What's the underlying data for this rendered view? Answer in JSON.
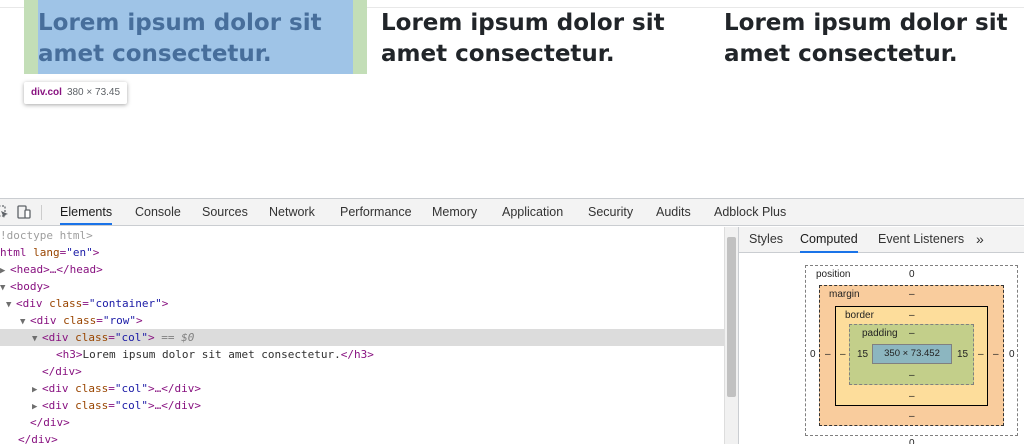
{
  "page": {
    "columns": [
      {
        "heading": "Lorem ipsum dolor sit amet consectetur."
      },
      {
        "heading": "Lorem ipsum dolor sit amet consectetur."
      },
      {
        "heading": "Lorem ipsum dolor sit amet consectetur."
      }
    ],
    "tooltip": {
      "tag": "div.col",
      "dims": "380 × 73.45"
    }
  },
  "devtools": {
    "tabs": [
      "Elements",
      "Console",
      "Sources",
      "Network",
      "Performance",
      "Memory",
      "Application",
      "Security",
      "Audits",
      "Adblock Plus"
    ],
    "active_tab": "Elements",
    "dom_lines": {
      "l0": "!doctype html>",
      "l1_tag": "html",
      "l1_attr": "lang",
      "l1_val": "\"en\"",
      "l2": "<head>…</head>",
      "l3": "<body>",
      "l4_tag": "<div",
      "l4_attr": "class",
      "l4_val": "\"container\"",
      "l5_val": "\"row\"",
      "l6_val": "\"col\"",
      "l6_suffix": "== $0",
      "l7_open": "<h3>",
      "l7_text": "Lorem ipsum dolor sit amet consectetur.",
      "l7_close": "</h3>",
      "l8": "</div>",
      "l9_val": "\"col\"",
      "l9_tail": "…</div>",
      "l10_val": "\"col\"",
      "l10_tail": "…</div>",
      "l11": "</div>",
      "l12": "</div>"
    },
    "side_tabs": [
      "Styles",
      "Computed",
      "Event Listeners",
      "»"
    ],
    "active_side_tab": "Computed",
    "box_model": {
      "position_label": "position",
      "position_top": "0",
      "position_bottom": "0",
      "position_left": "0",
      "position_right": "0",
      "margin_label": "margin",
      "margin_value": "–",
      "border_label": "border",
      "border_value": "–",
      "padding_label": "padding",
      "padding_top": "–",
      "padding_bottom": "–",
      "padding_left": "15",
      "padding_right": "15",
      "content_size": "350 × 73.452"
    }
  }
}
